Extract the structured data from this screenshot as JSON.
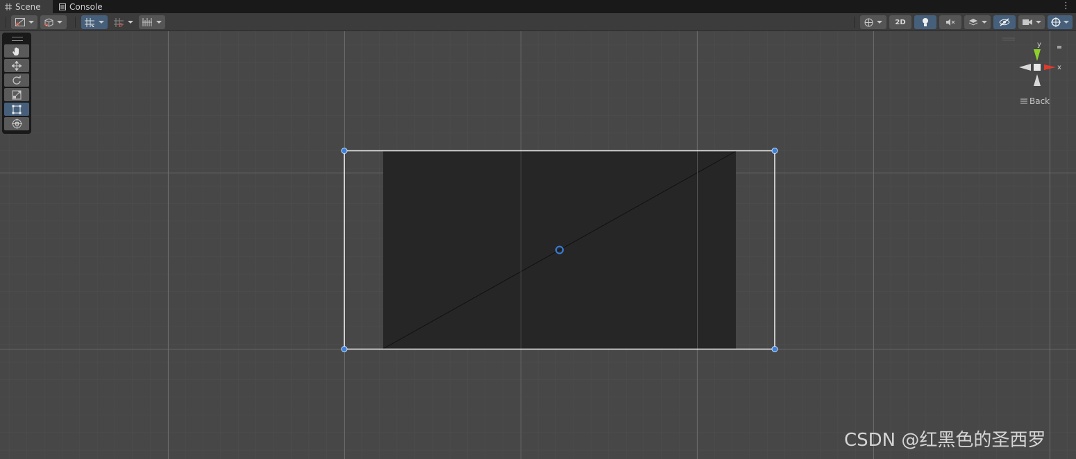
{
  "tabs": [
    {
      "label": "Scene",
      "icon": "grid-icon",
      "active": true
    },
    {
      "label": "Console",
      "icon": "console-icon",
      "active": false
    }
  ],
  "toolbar": {
    "view_2d_label": "2D"
  },
  "tools": [
    {
      "name": "hand-tool",
      "icon": "hand-icon",
      "active": false
    },
    {
      "name": "move-tool",
      "icon": "move-icon",
      "active": false
    },
    {
      "name": "rotate-tool",
      "icon": "rotate-icon",
      "active": false
    },
    {
      "name": "scale-tool",
      "icon": "scale-icon",
      "active": false
    },
    {
      "name": "rect-tool",
      "icon": "rect-icon",
      "active": true
    },
    {
      "name": "transform-tool",
      "icon": "transform-icon",
      "active": false
    }
  ],
  "gizmo": {
    "y_label": "y",
    "x_label": "x",
    "view_label": "Back"
  },
  "colors": {
    "accent": "#46607c",
    "handle": "#3a7fd9",
    "gizmo_y": "#8ed12a",
    "gizmo_x": "#e03a2b"
  },
  "watermark": "CSDN @红黑色的圣西罗"
}
